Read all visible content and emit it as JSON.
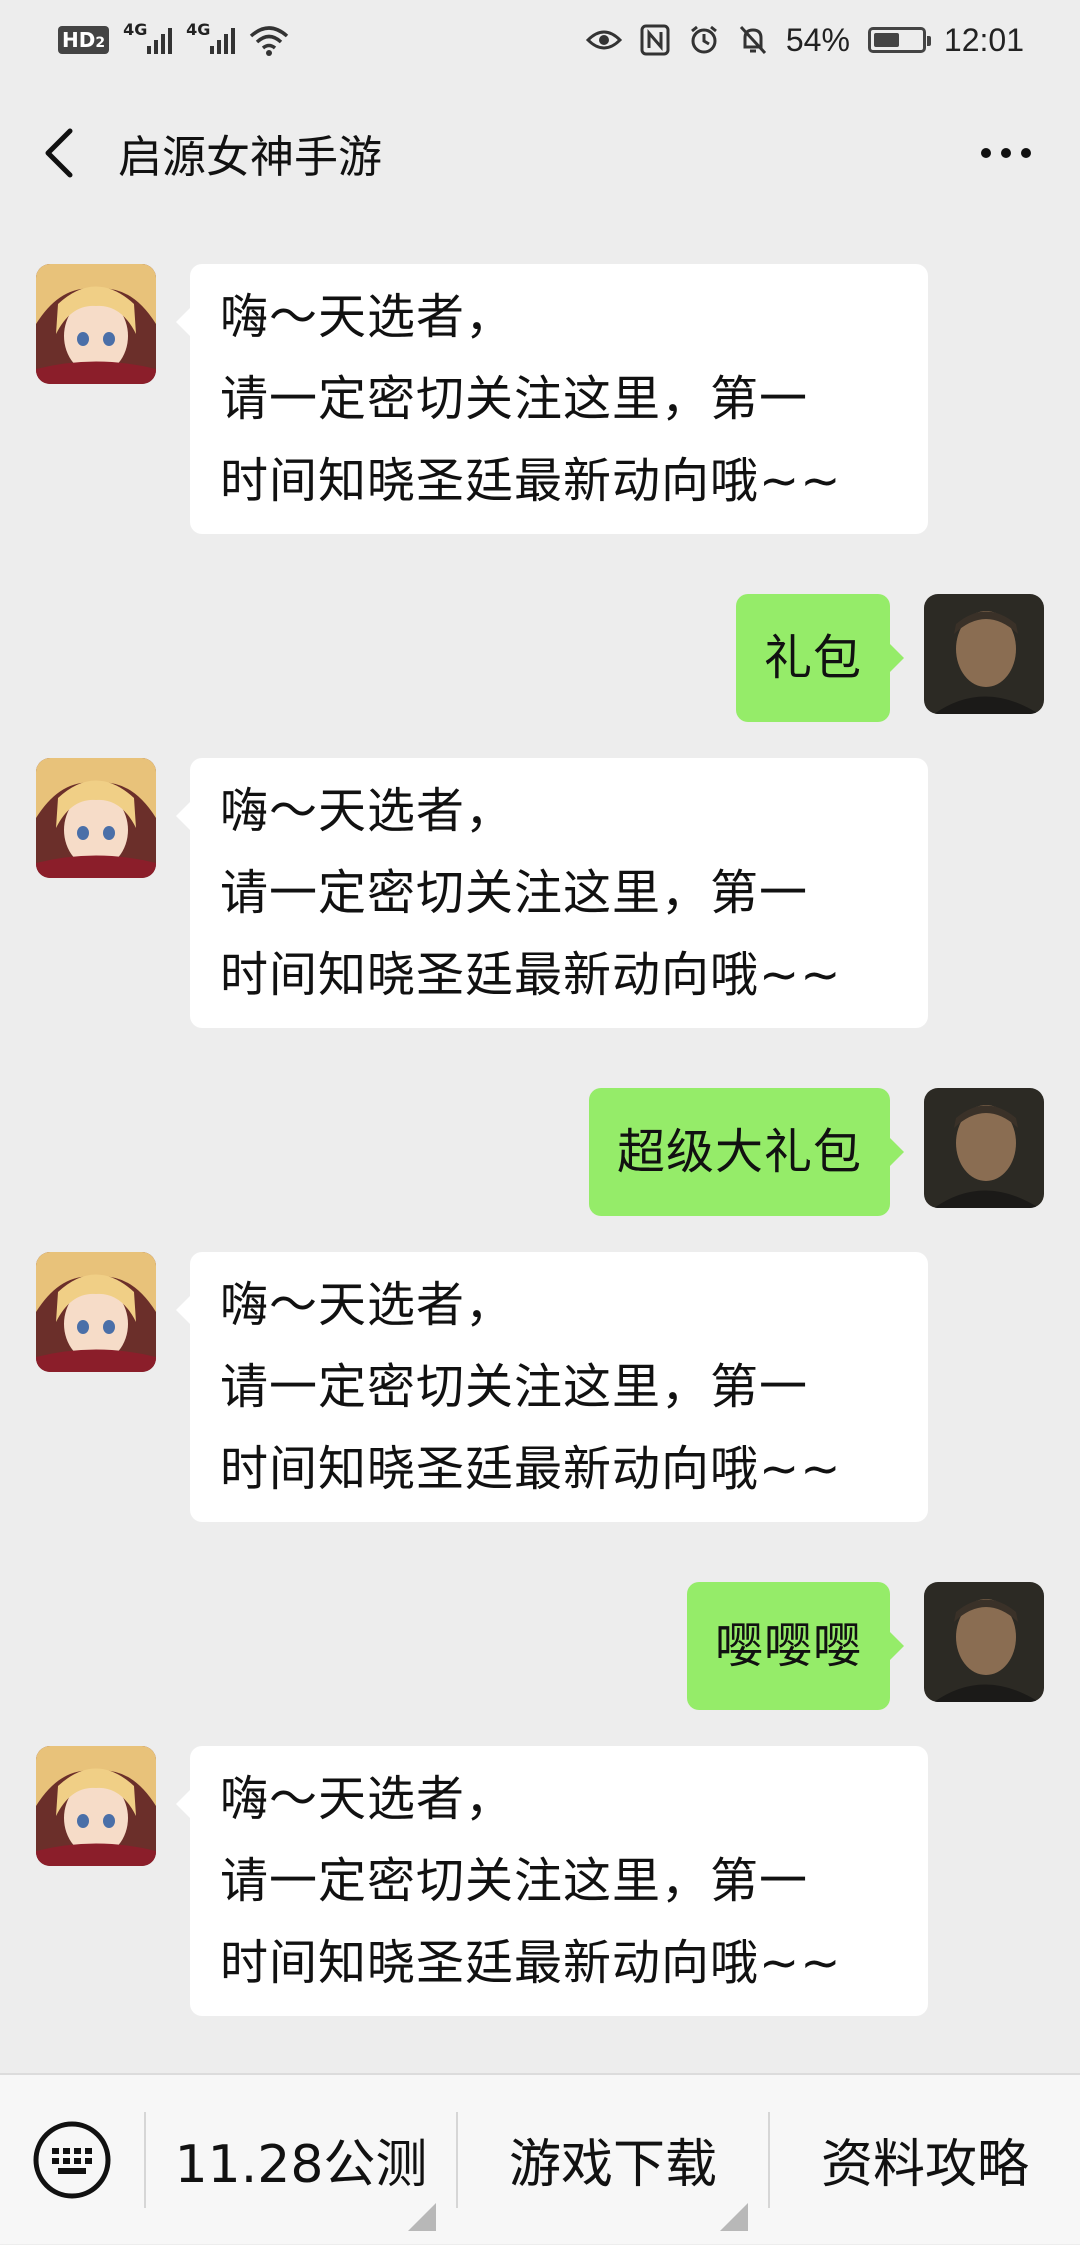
{
  "status_bar": {
    "hd_label": "HD",
    "sim_label": "2",
    "network1": "4G",
    "network2": "4G",
    "battery_percent": "54%",
    "battery_level": 0.54,
    "time": "12:01"
  },
  "nav": {
    "title": "启源女神手游"
  },
  "messages": [
    {
      "side": "left",
      "lines": [
        "嗨～天选者，",
        "请一定密切关注这里，第一",
        "时间知晓圣廷最新动向哦~~"
      ]
    },
    {
      "side": "right",
      "text": "礼包"
    },
    {
      "side": "left",
      "lines": [
        "嗨～天选者，",
        "请一定密切关注这里，第一",
        "时间知晓圣廷最新动向哦~~"
      ]
    },
    {
      "side": "right",
      "text": "超级大礼包"
    },
    {
      "side": "left",
      "lines": [
        "嗨～天选者，",
        "请一定密切关注这里，第一",
        "时间知晓圣廷最新动向哦~~"
      ]
    },
    {
      "side": "right",
      "text": "嘤嘤嘤"
    },
    {
      "side": "left",
      "lines": [
        "嗨～天选者，",
        "请一定密切关注这里，第一",
        "时间知晓圣廷最新动向哦~~"
      ]
    }
  ],
  "bottom_menu": {
    "items": [
      "11.28公测",
      "游戏下载",
      "资料攻略"
    ]
  },
  "colors": {
    "background": "#ededed",
    "bubble_self": "#95ec69",
    "bubble_other": "#ffffff"
  },
  "icons": {
    "back": "chevron-left-icon",
    "more": "more-dots-icon",
    "keyboard": "keyboard-icon",
    "eye": "eye-icon",
    "nfc": "nfc-icon",
    "alarm": "alarm-icon",
    "mute": "bell-off-icon",
    "wifi": "wifi-icon"
  }
}
